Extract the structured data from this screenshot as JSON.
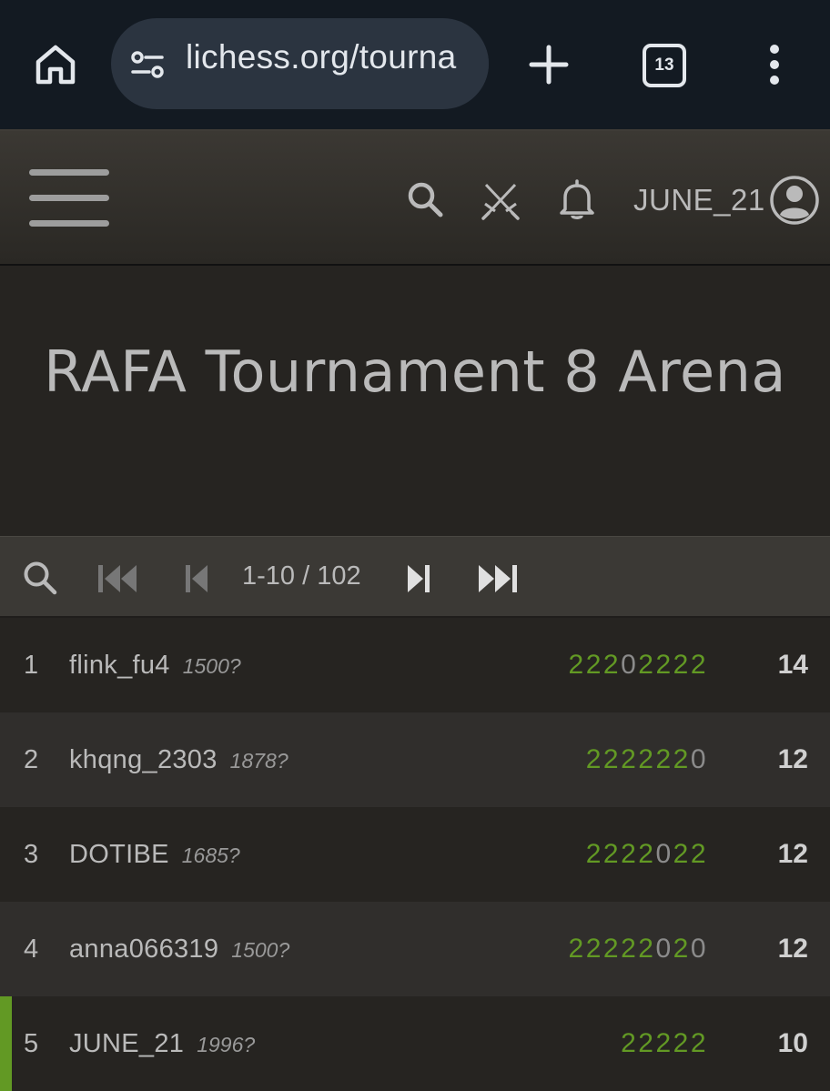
{
  "browser": {
    "url": "lichess.org/tourna",
    "tab_count": "13"
  },
  "header": {
    "username": "JUNE_21"
  },
  "tournament": {
    "title": "RAFA Tournament 8 Arena"
  },
  "pager": {
    "range": "1-10 / 102"
  },
  "standings": [
    {
      "rank": "1",
      "name": "flink_fu4",
      "rating": "1500?",
      "sheet": "22202222",
      "total": "14"
    },
    {
      "rank": "2",
      "name": "khqng_2303",
      "rating": "1878?",
      "sheet": "2222220",
      "total": "12"
    },
    {
      "rank": "3",
      "name": "DOTIBE",
      "rating": "1685?",
      "sheet": "2222022",
      "total": "12"
    },
    {
      "rank": "4",
      "name": "anna066319",
      "rating": "1500?",
      "sheet": "22222020",
      "total": "12"
    },
    {
      "rank": "5",
      "name": "JUNE_21",
      "rating": "1996?",
      "sheet": "22222",
      "total": "10"
    }
  ],
  "colors": {
    "accent": "#629924",
    "browser_bar": "#131a22",
    "background": "#262421"
  }
}
